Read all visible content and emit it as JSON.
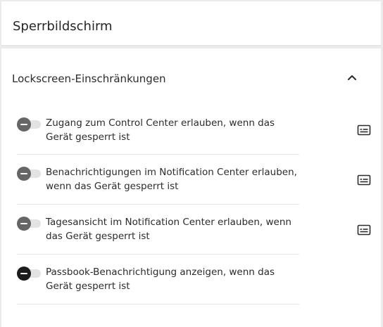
{
  "header": {
    "title": "Sperrbildschirm"
  },
  "section": {
    "title": "Lockscreen-Einschränkungen",
    "collapse_icon": "chevron-up-icon"
  },
  "rows": [
    {
      "label": "Zugang zum Control Center erlauben, wenn das Gerät gesperrt ist",
      "enabled": false,
      "detail_icon": "subtitles-icon"
    },
    {
      "label": "Benachrichtigungen im Notification Center erlauben, wenn das Gerät gesperrt ist",
      "enabled": false,
      "detail_icon": "subtitles-icon"
    },
    {
      "label": "Tagesansicht im Notification Center erlauben, wenn das Gerät gesperrt ist",
      "enabled": false,
      "detail_icon": "subtitles-icon"
    },
    {
      "label": "Passbook-Benachrichtigung anzeigen, wenn das Gerät gesperrt ist",
      "enabled": false
    }
  ],
  "colors": {
    "background": "#ebebeb",
    "card": "#ffffff",
    "toggle_knob": "#666666",
    "toggle_knob_dark": "#1c1c1c",
    "toggle_track": "#e3e3e3",
    "divider": "#e6e6e6"
  }
}
